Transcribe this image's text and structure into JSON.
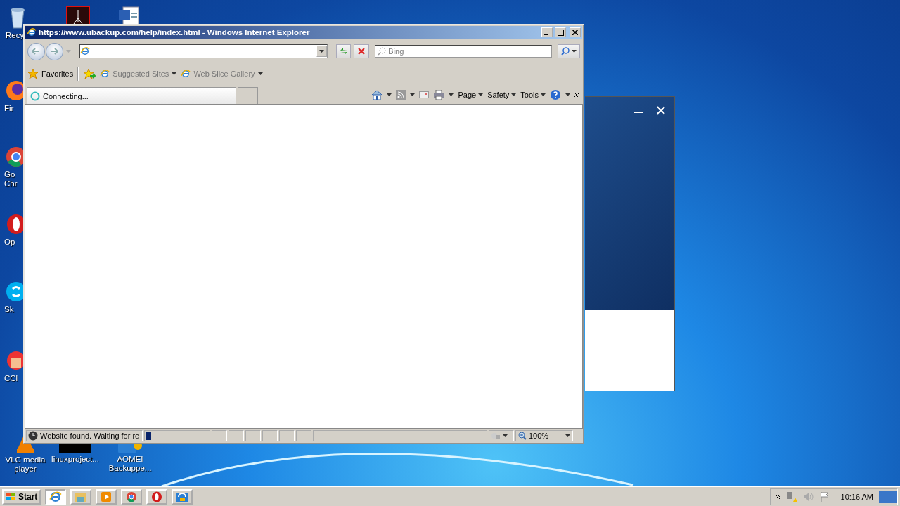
{
  "desktop_icons": [
    {
      "kind": "recycle",
      "lines": [
        "Recy"
      ]
    },
    {
      "kind": "pdf"
    },
    {
      "kind": "word"
    },
    {
      "kind": "firefox",
      "lines": [
        "Fir"
      ]
    },
    {
      "kind": "chrome",
      "lines": [
        "Go",
        "Chr"
      ]
    },
    {
      "kind": "opera",
      "lines": [
        "Op"
      ]
    },
    {
      "kind": "skype",
      "lines": [
        "Sk"
      ]
    },
    {
      "kind": "ccleaner",
      "lines": [
        "CCl"
      ]
    },
    {
      "kind": "vlc",
      "lines": [
        "VLC media",
        "player"
      ]
    },
    {
      "kind": "blackapp",
      "lines": [
        "linuxproject..."
      ]
    },
    {
      "kind": "aomei",
      "lines": [
        "AOMEI",
        "Backuppe..."
      ]
    }
  ],
  "background_window": {
    "visible": true
  },
  "browser": {
    "title": "https://www.ubackup.com/help/index.html - Windows Internet Explorer",
    "search": {
      "placeholder": "Bing"
    },
    "favorites": "Favorites",
    "favorite_links": [
      "Suggested Sites",
      "Web Slice Gallery"
    ],
    "tab": {
      "title": "Connecting..."
    },
    "commands": [
      "Page",
      "Safety",
      "Tools"
    ],
    "status": "Website found. Waiting for re",
    "progress": {
      "level": 0.08
    },
    "zoom": "100%"
  },
  "taskbar": {
    "start": "Start",
    "items": [
      {
        "kind": "ie",
        "selected": true
      },
      {
        "kind": "folder",
        "selected": false
      },
      {
        "kind": "media",
        "selected": false
      },
      {
        "kind": "chrome",
        "selected": false
      },
      {
        "kind": "opera",
        "selected": false
      },
      {
        "kind": "aomei",
        "selected": false
      }
    ],
    "clock": "10:16 AM"
  }
}
